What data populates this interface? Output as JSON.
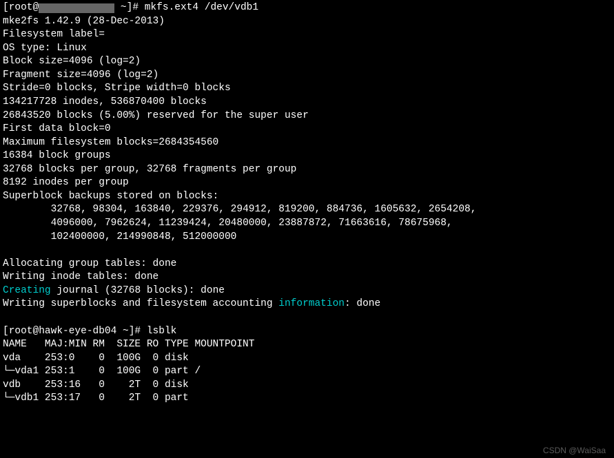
{
  "prompt1": {
    "prefix": "[root@",
    "host_obscured": "XXXXXXXXXXXXX",
    "suffix": " ~]# ",
    "command": "mkfs.ext4 /dev/vdb1"
  },
  "mkfs": {
    "version_line": "mke2fs 1.42.9 (28-Dec-2013)",
    "fs_label": "Filesystem label=",
    "ostype": "OS type: Linux",
    "blocksize": "Block size=4096 (log=2)",
    "fragsize": "Fragment size=4096 (log=2)",
    "stride": "Stride=0 blocks, Stripe width=0 blocks",
    "inodes": "134217728 inodes, 536870400 blocks",
    "reserved": "26843520 blocks (5.00%) reserved for the super user",
    "firstdata": "First data block=0",
    "maxblocks": "Maximum filesystem blocks=2684354560",
    "groups": "16384 block groups",
    "pergroup": "32768 blocks per group, 32768 fragments per group",
    "inodespergroup": "8192 inodes per group",
    "sb_intro": "Superblock backups stored on blocks: ",
    "sb_line1": "\t32768, 98304, 163840, 229376, 294912, 819200, 884736, 1605632, 2654208, ",
    "sb_line2": "\t4096000, 7962624, 11239424, 20480000, 23887872, 71663616, 78675968, ",
    "sb_line3": "\t102400000, 214990848, 512000000",
    "alloc_tables": "Allocating group tables: done                            ",
    "inode_tables": "Writing inode tables: done                            ",
    "creating_word": "Creating",
    "journal_rest": " journal (32768 blocks): done",
    "super_write_pre": "Writing superblocks and filesystem accounting ",
    "info_word": "information",
    "super_write_post": ": done"
  },
  "prompt2": {
    "full_prefix": "[root@hawk-eye-db04 ~]# ",
    "command": "lsblk"
  },
  "lsblk": {
    "header": "NAME   MAJ:MIN RM  SIZE RO TYPE MOUNTPOINT",
    "rows": [
      "vda    253:0    0  100G  0 disk ",
      "└─vda1 253:1    0  100G  0 part /",
      "vdb    253:16   0    2T  0 disk ",
      "└─vdb1 253:17   0    2T  0 part "
    ]
  },
  "watermark": "CSDN @WaiSaa"
}
